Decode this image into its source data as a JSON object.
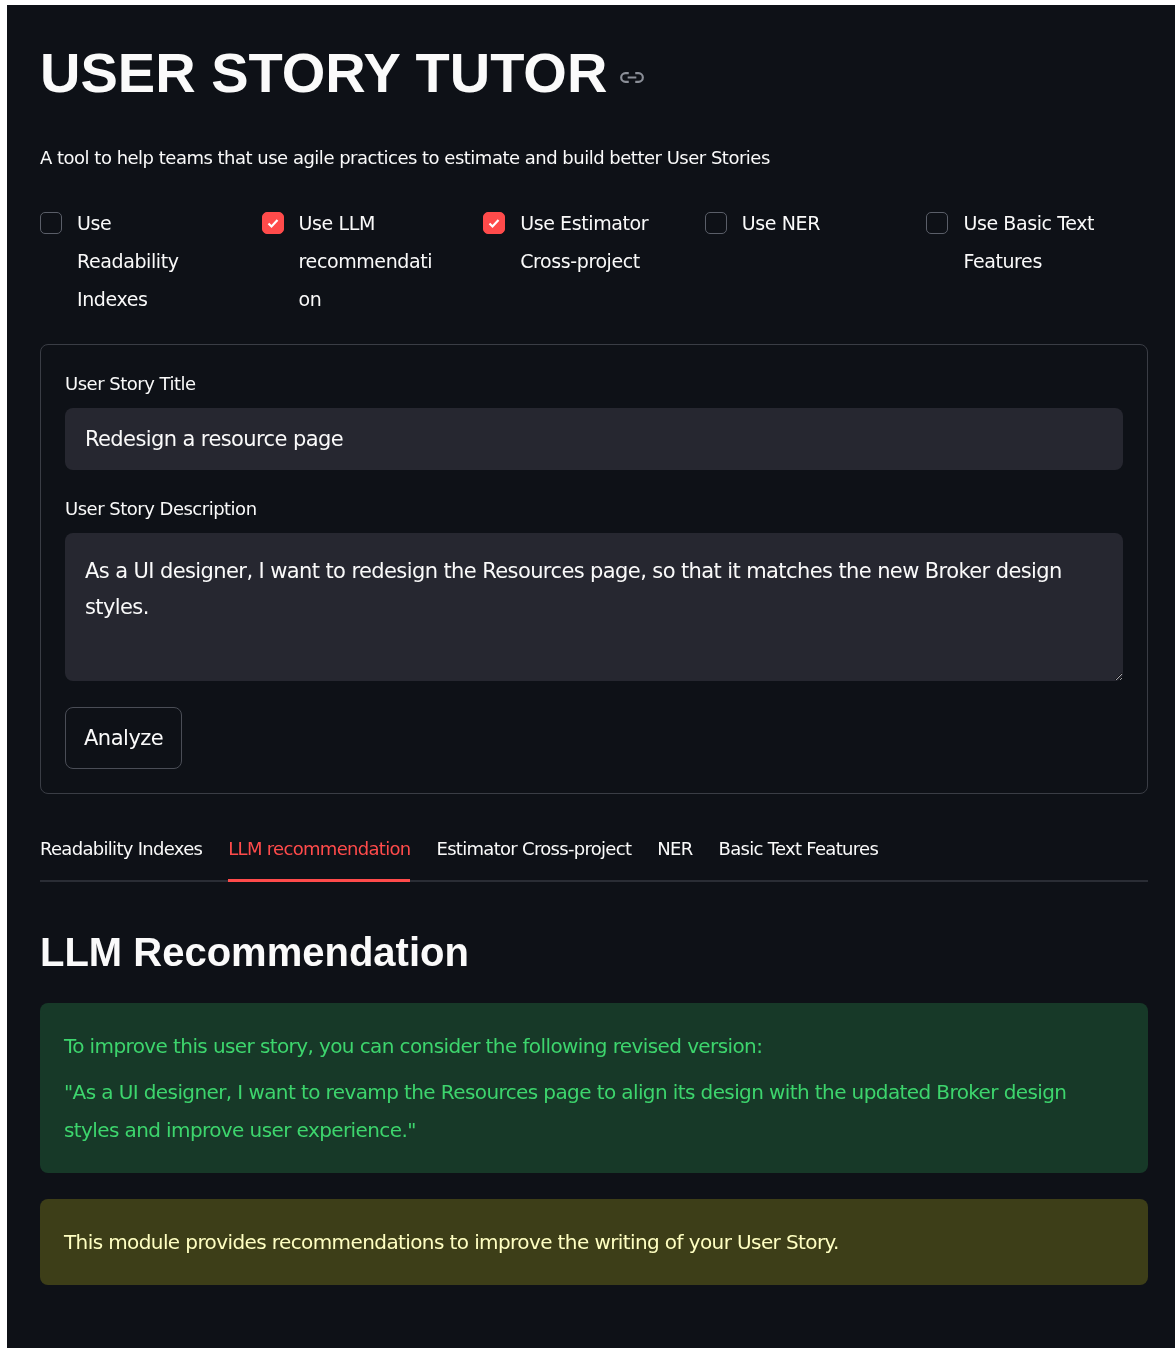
{
  "title": "USER STORY TUTOR",
  "subtitle": "A tool to help teams that use agile practices to estimate and build better User Stories",
  "options": [
    {
      "label": "Use Readability Indexes",
      "checked": false
    },
    {
      "label": "Use LLM recommendation",
      "checked": true
    },
    {
      "label": "Use Estimator Cross-project",
      "checked": true
    },
    {
      "label": "Use NER",
      "checked": false
    },
    {
      "label": "Use Basic Text Features",
      "checked": false
    }
  ],
  "form": {
    "title_label": "User Story Title",
    "title_value": "Redesign a resource page",
    "description_label": "User Story Description",
    "description_value": "As a UI designer, I want to redesign the Resources page, so that it matches the new Broker design styles.",
    "button": "Analyze"
  },
  "tabs": [
    {
      "label": "Readability Indexes",
      "selected": false
    },
    {
      "label": "LLM recommendation",
      "selected": true
    },
    {
      "label": "Estimator Cross-project",
      "selected": false
    },
    {
      "label": "NER",
      "selected": false
    },
    {
      "label": "Basic Text Features",
      "selected": false
    }
  ],
  "section_heading": "LLM Recommendation",
  "alerts": [
    {
      "kind": "success",
      "paragraphs": [
        "To improve this user story, you can consider the following revised version:",
        "\"As a UI designer, I want to revamp the Resources page to align its design with the updated Broker design styles and improve user experience.\""
      ]
    },
    {
      "kind": "warning",
      "paragraphs": [
        "This module provides recommendations to improve the writing of your User Story."
      ]
    }
  ]
}
